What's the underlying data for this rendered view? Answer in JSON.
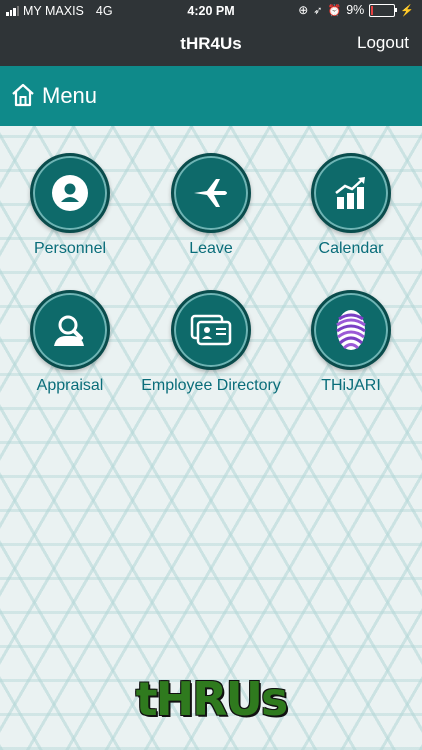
{
  "status_bar": {
    "carrier": "MY MAXIS",
    "network": "4G",
    "time": "4:20 PM",
    "battery": "9%",
    "battery_level": 0.09
  },
  "nav": {
    "title": "tHR4Us",
    "logout_label": "Logout"
  },
  "menu_header": {
    "title": "Menu"
  },
  "tiles": [
    {
      "label": "Personnel",
      "icon": "person-icon"
    },
    {
      "label": "Leave",
      "icon": "airplane-icon"
    },
    {
      "label": "Calendar",
      "icon": "chart-icon"
    },
    {
      "label": "Appraisal",
      "icon": "appraisal-icon"
    },
    {
      "label": "Employee Directory",
      "icon": "id-card-icon"
    },
    {
      "label": "THiJARI",
      "icon": "fingerprint-icon"
    }
  ],
  "logo_text": "tHRUs",
  "colors": {
    "bar": "#2f3437",
    "teal": "#0f8a8a",
    "circle": "#0e6a6a",
    "label": "#0a6d7a"
  }
}
